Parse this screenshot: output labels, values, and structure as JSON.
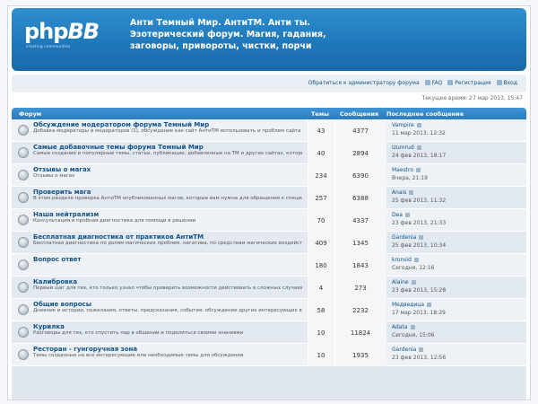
{
  "header": {
    "logo_text": "php",
    "logo_bb": "BB",
    "logo_sub": "creating communities",
    "site_title": "Анти Темный Мир. АнтиТМ. Анти ты. Эзотерический форум. Магия, гадания, заговоры, привороты, чистки, порчи"
  },
  "navbar": {
    "links": [
      {
        "label": "Обратиться к администратору форума"
      },
      {
        "label": "FAQ"
      },
      {
        "label": "Регистрация"
      },
      {
        "label": "Вход"
      }
    ]
  },
  "time_line": "Текущее время: 27 мар 2013, 15:47",
  "table": {
    "headers": {
      "forum": "Форум",
      "topics": "Темы",
      "posts": "Сообщения",
      "last_post": "Последнее сообщение"
    },
    "rows": [
      {
        "name": "Обсуждение модератором форума Темный Мир",
        "desc": "Добавка модераторы и модераторов (1), обсуждение как сайт АнтиТМ использовать и проблем сайта",
        "topics": "43",
        "posts": "4377",
        "last_user": "Vampire",
        "last_date": "11 мар 2013, 12:32"
      },
      {
        "name": "Самые добавочные темы форума Темный Мир",
        "desc": "Самые создание и популярные темы, статьи, публикации, добавленные на ТМ и других сайтах, которые могут быть полезными",
        "topics": "40",
        "posts": "2894",
        "last_user": "Izumrud",
        "last_date": "24 фев 2013, 18:17"
      },
      {
        "name": "Отзывы о магах",
        "desc": "Отзывы о магах",
        "topics": "234",
        "posts": "6390",
        "last_user": "Maestro",
        "last_date": "Вчера, 21:19"
      },
      {
        "name": "Проверить мага",
        "desc": "В этом разделе проверка АнтиТМ опубликованных магов, которые вам нужна для обращения к специалистам",
        "topics": "257",
        "posts": "6388",
        "last_user": "Anais",
        "last_date": "25 фев 2013, 11:32"
      },
      {
        "name": "Наша нейтрализм",
        "desc": "Консультация и пробная диагностика для помощи в решении",
        "topics": "70",
        "posts": "4337",
        "last_user": "Dea",
        "last_date": "23 фев 2013, 21:33"
      },
      {
        "name": "Бесплатная диагностика от практиков АнтиТМ",
        "desc": "Бесплатная диагностика по ролям магических проблем, негатива, по средствам магических воздействий, порча, проклятия, привороты",
        "topics": "409",
        "posts": "1345",
        "last_user": "Gardenia",
        "last_date": "25 фев 2013, 10:34"
      },
      {
        "name": "Вопрос ответ",
        "desc": "",
        "topics": "180",
        "posts": "1843",
        "last_user": "kronsid",
        "last_date": "Сегодня, 12:16"
      },
      {
        "name": "Калибровка",
        "desc": "Первый шаг для тех, кто только узнал чтобы проверить возможности действовать в сложных случаях",
        "topics": "4",
        "posts": "273",
        "last_user": "Alaine",
        "last_date": "23 фев 2013, 15:28"
      },
      {
        "name": "Общие вопросы",
        "desc": "Дневник и истории, пожелания, ответы, предсказания, события, обсуждение других интересующих вас вопросов с участниками форума",
        "topics": "58",
        "posts": "2232",
        "last_user": "Медведица",
        "last_date": "17 мар 2013, 18:29"
      },
      {
        "name": "Курилка",
        "desc": "Разговоры для тех, кто спустить пар в общении и поделиться своими знаниями",
        "topics": "10",
        "posts": "11824",
        "last_user": "Adata",
        "last_date": "Сегодня, 15:06"
      },
      {
        "name": "Ресторан - гунгоручная зона",
        "desc": "Темы созданные на все интересующие или необходимые темы для обсуждения",
        "topics": "10",
        "posts": "1935",
        "last_user": "Gardenia",
        "last_date": "23 фев 2013, 12:56"
      }
    ]
  }
}
